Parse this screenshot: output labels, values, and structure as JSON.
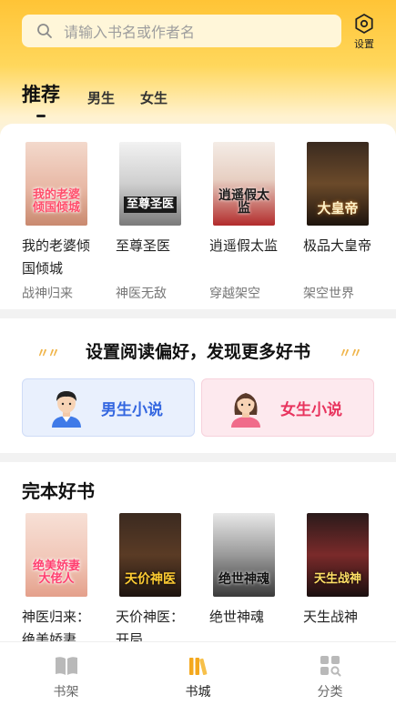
{
  "search": {
    "placeholder": "请输入书名或作者名"
  },
  "settings": {
    "label": "设置"
  },
  "tabs": [
    {
      "label": "推荐",
      "active": true
    },
    {
      "label": "男生"
    },
    {
      "label": "女生"
    }
  ],
  "recommend": [
    {
      "cover_text": "我的老婆倾国倾城",
      "name": "我的老婆倾国倾城",
      "category": "战神归来"
    },
    {
      "cover_text": "至尊圣医",
      "name": "至尊圣医",
      "category": "神医无敌"
    },
    {
      "cover_text": "逍遥假太监",
      "name": "逍遥假太监",
      "category": "穿越架空"
    },
    {
      "cover_text": "大皇帝",
      "name": "极品大皇帝",
      "category": "架空世界"
    }
  ],
  "preference": {
    "title": "设置阅读偏好，发现更多好书",
    "male_label": "男生小说",
    "female_label": "女生小说"
  },
  "completed": {
    "title": "完本好书",
    "books": [
      {
        "cover_text": "绝美娇妻大佬人",
        "name": "神医归来：绝美娇妻"
      },
      {
        "cover_text": "天价神医",
        "name": "天价神医：开局"
      },
      {
        "cover_text": "绝世神魂",
        "name": "绝世神魂"
      },
      {
        "cover_text": "天生战神",
        "name": "天生战神"
      }
    ]
  },
  "bottom_nav": [
    {
      "label": "书架",
      "icon": "bookshelf-icon"
    },
    {
      "label": "书城",
      "icon": "bookstore-icon",
      "active": true
    },
    {
      "label": "分类",
      "icon": "category-grid-icon"
    }
  ],
  "colors": {
    "accent": "#ffc436",
    "male": "#3366e0",
    "female": "#e8345e"
  }
}
